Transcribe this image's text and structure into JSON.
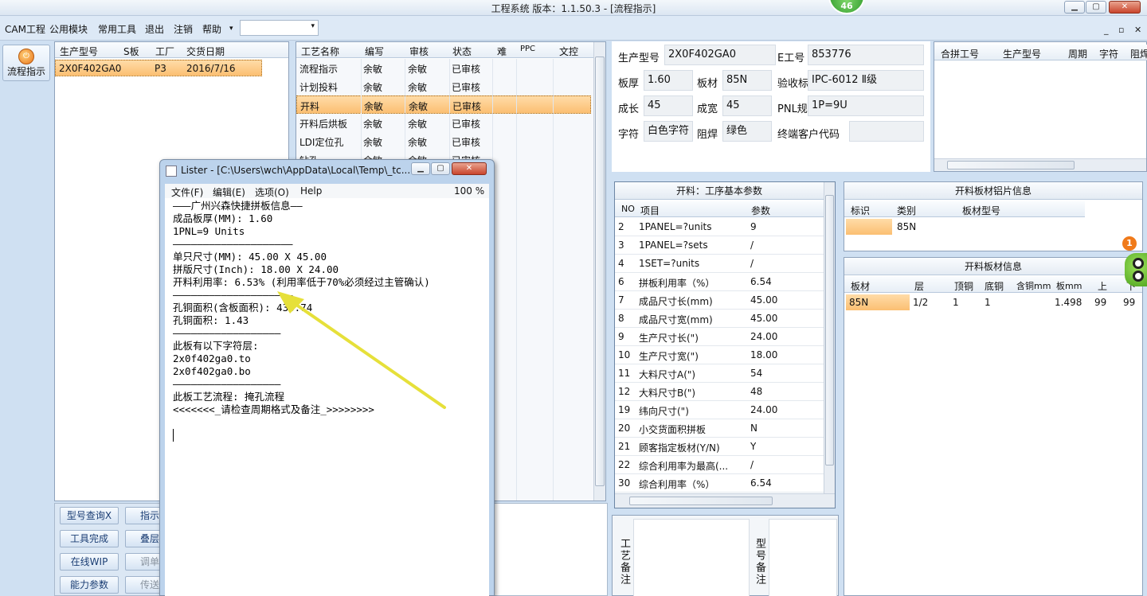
{
  "window": {
    "title": "工程系统   版本：1.1.50.3 - [流程指示]",
    "badge": "46"
  },
  "menu": {
    "items": [
      "CAM工程",
      "公用模块",
      "常用工具",
      "退出",
      "注销",
      "帮助"
    ],
    "mdi": [
      "_",
      "▫",
      "✕"
    ]
  },
  "left": {
    "flow_btn": "流程指示"
  },
  "order_grid": {
    "headers": [
      "生产型号",
      "S板",
      "工厂",
      "交货日期"
    ],
    "rows": [
      [
        "2X0F402GA0",
        "",
        "P3",
        "2016/7/16"
      ]
    ]
  },
  "process_grid": {
    "headers": [
      "工艺名称",
      "编写",
      "审核",
      "状态",
      "难",
      "PPC",
      "文控"
    ],
    "rows": [
      [
        "流程指示",
        "余敏",
        "余敏",
        "已审核"
      ],
      [
        "计划投料",
        "余敏",
        "余敏",
        "已审核"
      ],
      [
        "开料",
        "余敏",
        "余敏",
        "已审核"
      ],
      [
        "开料后烘板",
        "余敏",
        "余敏",
        "已审核"
      ],
      [
        "LDI定位孔",
        "余敏",
        "余敏",
        "已审核"
      ],
      [
        "钻孔",
        "余敏",
        "余敏",
        "已审核"
      ]
    ]
  },
  "buttons": [
    [
      "型号查询X",
      "指示审"
    ],
    [
      "工具完成",
      "叠层验"
    ],
    [
      "在线WIP",
      "调单导"
    ],
    [
      "能力参数",
      "传送文"
    ]
  ],
  "info": {
    "生产型号": "2X0F402GA0",
    "E工号": "853776",
    "板厚": "1.60",
    "板材": "85N",
    "验收标准": "IPC-6012 Ⅱ级",
    "成长": "45",
    "成宽": "45",
    "PNL规格": "1P=9U",
    "字符": "白色字符",
    "阻焊": "绿色",
    "终端客户代码": ""
  },
  "info_labels": {
    "a": "生产型号",
    "b": "E工号",
    "c": "板厚",
    "d": "板材",
    "e": "验收标准",
    "f": "成长",
    "g": "成宽",
    "h": "PNL规格",
    "i": "字符",
    "j": "阻焊",
    "k": "终端客户代码"
  },
  "merge_grid": {
    "headers": [
      "合拼工号",
      "生产型号",
      "周期",
      "字符",
      "阻焊"
    ]
  },
  "params": {
    "title": "开料：工序基本参数",
    "headers": [
      "NO",
      "项目",
      "参数"
    ],
    "rows": [
      [
        "2",
        "1PANEL=?units",
        "9"
      ],
      [
        "3",
        "1PANEL=?sets",
        "/"
      ],
      [
        "4",
        "1SET=?units",
        "/"
      ],
      [
        "6",
        "拼板利用率（%）",
        "6.54"
      ],
      [
        "7",
        "成品尺寸长(mm)",
        "45.00"
      ],
      [
        "8",
        "成品尺寸宽(mm)",
        "45.00"
      ],
      [
        "9",
        "生产尺寸长(\")",
        "24.00"
      ],
      [
        "10",
        "生产尺寸宽(\")",
        "18.00"
      ],
      [
        "11",
        "大料尺寸A(\")",
        "54"
      ],
      [
        "12",
        "大料尺寸B(\")",
        "48"
      ],
      [
        "19",
        "纬向尺寸(\")",
        "24.00"
      ],
      [
        "20",
        "小交货面积拼板",
        "N"
      ],
      [
        "21",
        "顾客指定板材(Y/N)",
        "Y"
      ],
      [
        "22",
        "综合利用率为最高(...",
        "/"
      ],
      [
        "30",
        "综合利用率（%）",
        "6.54"
      ]
    ]
  },
  "foil": {
    "title": "开料板材铝片信息",
    "headers": [
      "标识",
      "类别",
      "板材型号"
    ],
    "rows": [
      [
        "",
        "85N",
        ""
      ]
    ]
  },
  "board": {
    "title": "开料板材信息",
    "headers": [
      "板材",
      "层",
      "顶铜",
      "底铜",
      "含铜mm",
      "板mm",
      "上",
      "下"
    ],
    "rows": [
      [
        "85N",
        "1/2",
        "1",
        "1",
        "",
        "1.498",
        "99",
        "99"
      ]
    ],
    "notif": "1"
  },
  "notes": {
    "proc": "工艺备注",
    "model": "型号备注"
  },
  "lister": {
    "title": "Lister - [C:\\Users\\wch\\AppData\\Local\\Temp\\_tc...",
    "menu": [
      "文件(F)",
      "编辑(E)",
      "选项(O)",
      "Help"
    ],
    "zoom": "100 %",
    "lines": [
      "———广州兴森快捷拼板信息——",
      "成品板厚(MM): 1.60",
      "1PNL=9 Units",
      "————————————————————",
      "单只尺寸(MM): 45.00 X 45.00",
      "拼版尺寸(Inch): 18.00 X 24.00",
      "开料利用率: 6.53% (利用率低于70%必须经过主管确认)",
      "————————————————————",
      "孔铜面积(含板面积): 433.74",
      "孔铜面积: 1.43",
      "——————————————————",
      "此板有以下字符层:",
      "2x0f402ga0.to",
      "2x0f402ga0.bo",
      "——————————————————",
      "此板工艺流程: 掩孔流程",
      "<<<<<<<_请检查周期格式及备注_>>>>>>>>"
    ]
  }
}
